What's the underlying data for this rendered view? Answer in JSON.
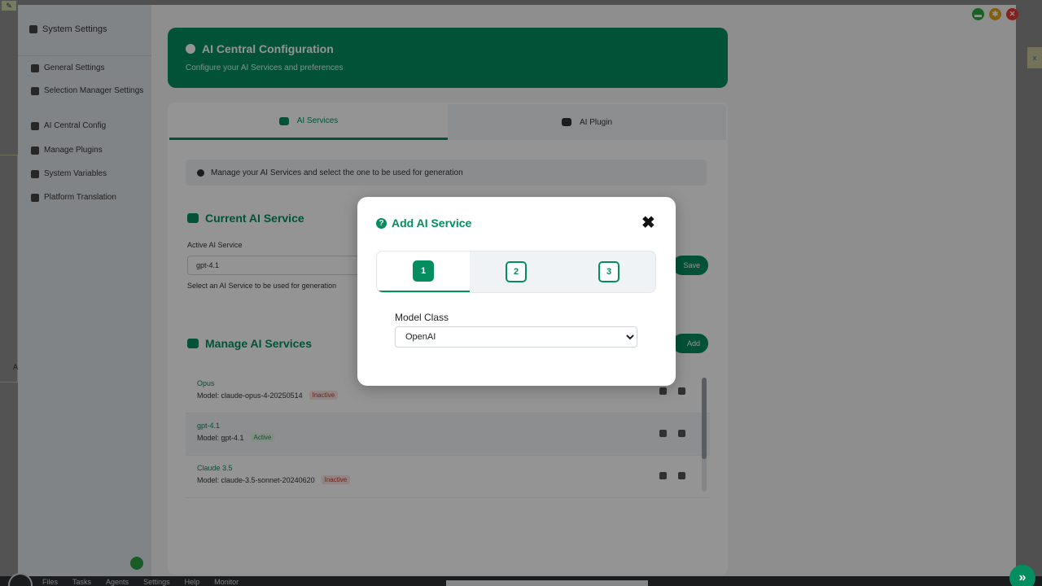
{
  "sidebar": {
    "title": "System Settings",
    "items": [
      {
        "label": "General Settings"
      },
      {
        "label": "Selection Manager Settings"
      },
      {
        "label": "AI Central Config"
      },
      {
        "label": "Manage Plugins"
      },
      {
        "label": "System Variables"
      },
      {
        "label": "Platform Translation"
      }
    ]
  },
  "header": {
    "title": "AI Central Configuration",
    "subtitle": "Configure your AI Services and preferences"
  },
  "tabs": [
    {
      "label": "AI Services"
    },
    {
      "label": "AI Plugin"
    }
  ],
  "info": {
    "text": "Manage your AI Services and select the one to be used for generation"
  },
  "current": {
    "title": "Current AI Service",
    "label": "Active AI Service",
    "value": "gpt-4.1",
    "help": "Select an AI Service to be used for generation",
    "button": "Save"
  },
  "manage": {
    "title": "Manage AI Services",
    "button": "Add"
  },
  "services": [
    {
      "name": "Opus",
      "model": "Model: claude-opus-4-20250514",
      "status": "Inactive"
    },
    {
      "name": "gpt-4.1",
      "model": "Model: gpt-4.1",
      "status": "Active"
    },
    {
      "name": "Claude 3.5",
      "model": "Model: claude-3.5-sonnet-20240620",
      "status": "Inactive"
    }
  ],
  "modal": {
    "title": "Add AI Service",
    "steps": [
      "1",
      "2",
      "3"
    ],
    "active_step": 1,
    "field_label": "Model Class",
    "field_value": "OpenAI",
    "close_glyph": "✖"
  },
  "window_controls": {
    "min": "▬",
    "pin": "✱",
    "close": "✕"
  },
  "side_tab": "x",
  "left_tag": "A",
  "taskbar": {
    "items": [
      "Files",
      "Tasks",
      "Agents",
      "Settings",
      "Help",
      "Monitor"
    ]
  },
  "fab_glyph": "»"
}
